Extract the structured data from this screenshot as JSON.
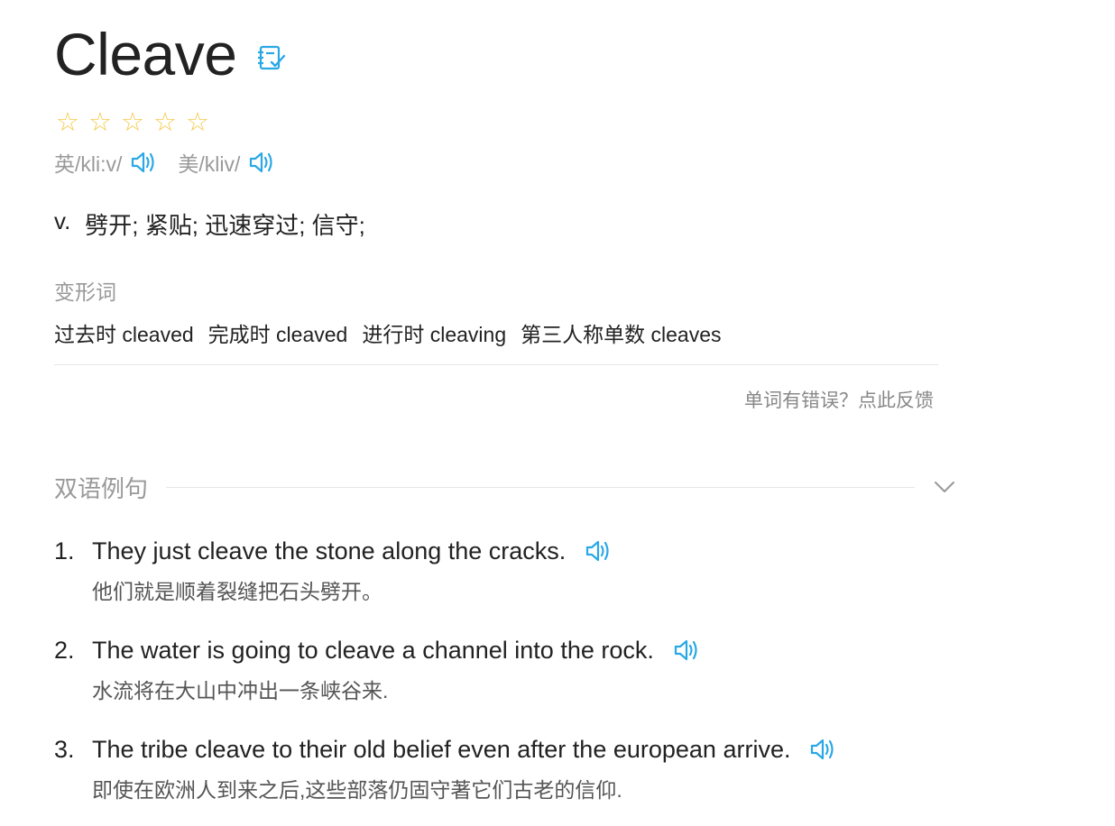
{
  "word": "Cleave",
  "rating": {
    "filled": 0,
    "total": 5,
    "star_glyph": "☆",
    "color": "#f5c94a"
  },
  "accent_color": "#2aa8e6",
  "phonetics": {
    "uk": {
      "label": "英/kli:v/",
      "icon": "speaker-icon"
    },
    "us": {
      "label": "美/kliv/",
      "icon": "speaker-icon"
    }
  },
  "definition": {
    "pos": "v.",
    "meaning": "劈开; 紧贴; 迅速穿过; 信守;"
  },
  "forms": {
    "label": "变形词",
    "items": [
      {
        "text": "过去时 cleaved"
      },
      {
        "text": "完成时 cleaved"
      },
      {
        "text": "进行时 cleaving"
      },
      {
        "text": "第三人称单数 cleaves"
      }
    ]
  },
  "feedback_link": "单词有错误？点此反馈",
  "examples_section": {
    "title": "双语例句",
    "items": [
      {
        "num": "1.",
        "en": "They just cleave the stone along the cracks.",
        "zh": "他们就是顺着裂缝把石头劈开。"
      },
      {
        "num": "2.",
        "en": "The water is going to cleave a channel into the rock.",
        "zh": "水流将在大山中冲出一条峡谷来."
      },
      {
        "num": "3.",
        "en": "The tribe cleave to their old belief even after the european arrive.",
        "zh": "即使在欧洲人到来之后,这些部落仍固守著它们古老的信仰."
      }
    ]
  }
}
